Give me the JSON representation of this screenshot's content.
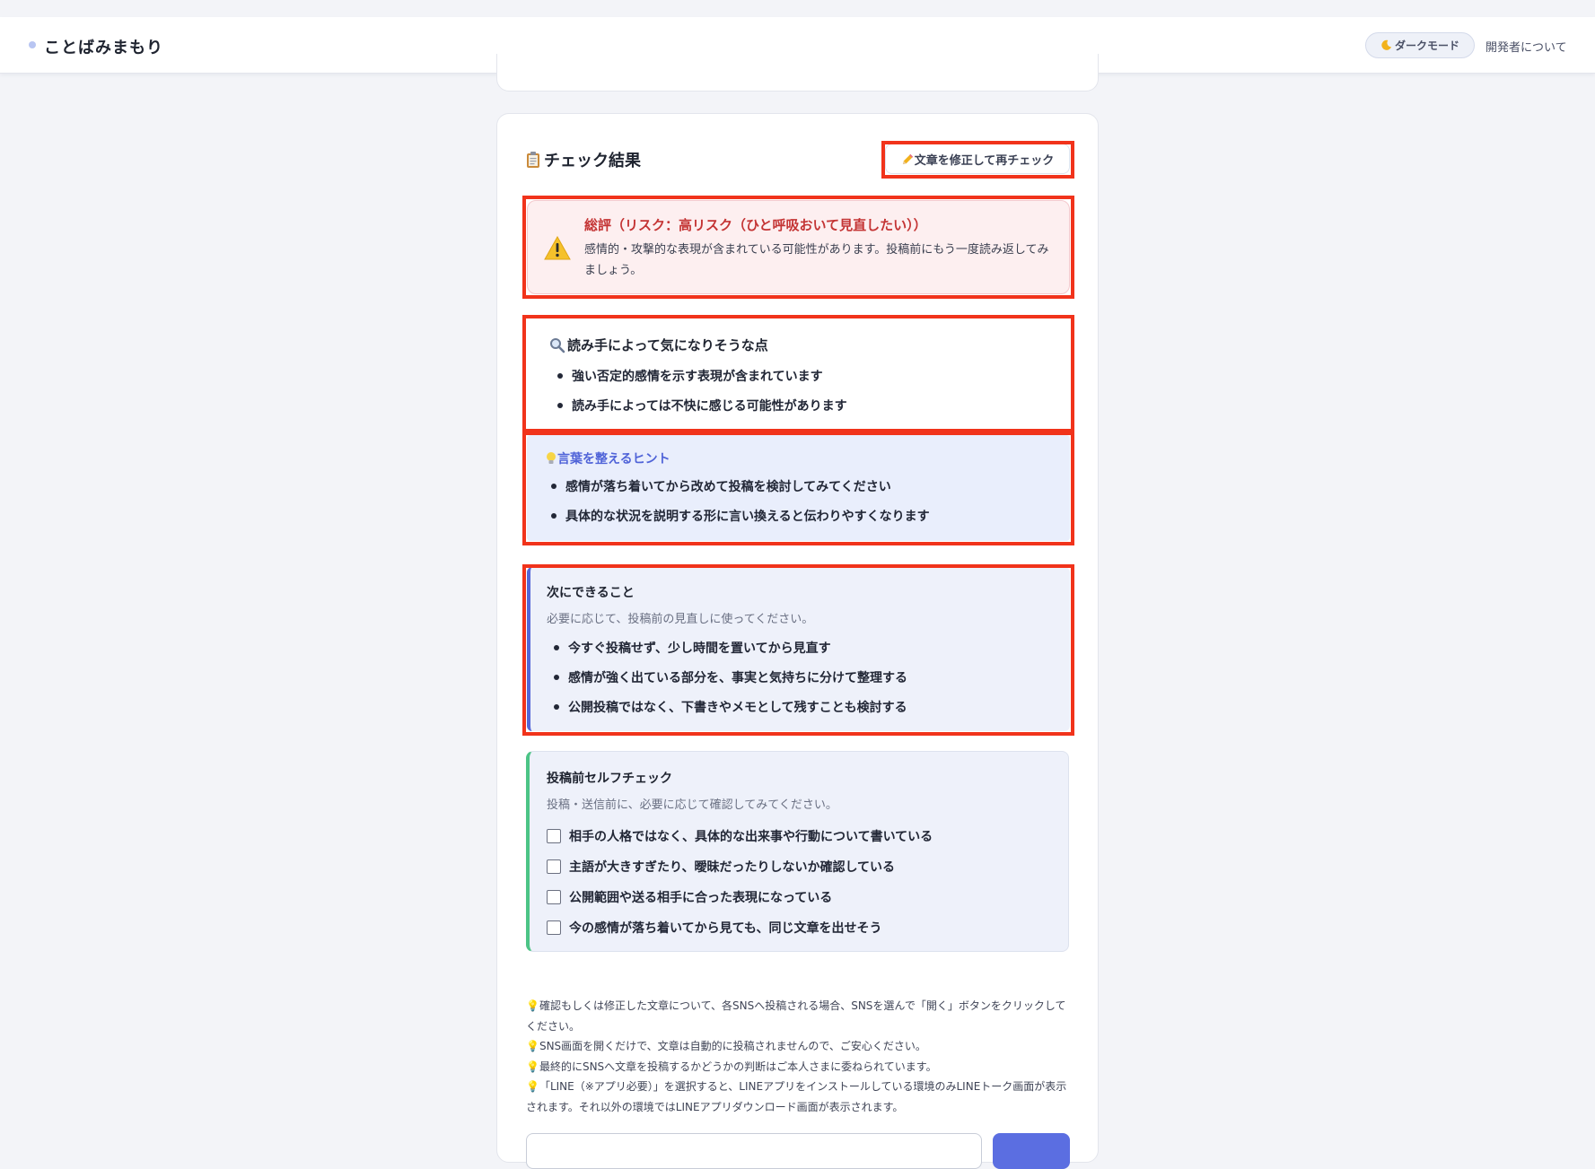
{
  "header": {
    "app_title": "ことばみまもり",
    "dark_mode_label": "ダークモード",
    "about_label": "開発者について"
  },
  "result": {
    "title": "チェック結果",
    "recheck_label": "文章を修正して再チェック",
    "summary_title": "総評（リスク：高リスク（ひと呼吸おいて見直したい））",
    "summary_text": "感情的・攻撃的な表現が含まれている可能性があります。投稿前にもう一度読み返してみましょう。"
  },
  "concerns": {
    "title": "読み手によって気になりそうな点",
    "items": [
      "強い否定的感情を示す表現が含まれています",
      "読み手によっては不快に感じる可能性があります"
    ]
  },
  "hints": {
    "title": "言葉を整えるヒント",
    "items": [
      "感情が落ち着いてから改めて投稿を検討してみてください",
      "具体的な状況を説明する形に言い換えると伝わりやすくなります"
    ]
  },
  "next_steps": {
    "title": "次にできること",
    "subtitle": "必要に応じて、投稿前の見直しに使ってください。",
    "items": [
      "今すぐ投稿せず、少し時間を置いてから見直す",
      "感情が強く出ている部分を、事実と気持ちに分けて整理する",
      "公開投稿ではなく、下書きやメモとして残すことも検討する"
    ]
  },
  "self_check": {
    "title": "投稿前セルフチェック",
    "subtitle": "投稿・送信前に、必要に応じて確認してみてください。",
    "items": [
      {
        "label": "相手の人格ではなく、具体的な出来事や行動について書いている",
        "checked": false
      },
      {
        "label": "主語が大きすぎたり、曖昧だったりしないか確認している",
        "checked": false
      },
      {
        "label": "公開範囲や送る相手に合った表現になっている",
        "checked": false
      },
      {
        "label": "今の感情が落ち着いてから見ても、同じ文章を出せそう",
        "checked": false
      }
    ]
  },
  "notes": [
    "確認もしくは修正した文章について、各SNSへ投稿される場合、SNSを選んで「開く」ボタンをクリックしてください。",
    "SNS画面を開くだけで、文章は自動的に投稿されませんので、ご安心ください。",
    "最終的にSNSへ文章を投稿するかどうかの判断はご本人さまに委ねられています。",
    "「LINE（※アプリ必要）」を選択すると、LINEアプリをインストールしている環境のみLINEトーク画面が表示されます。それ以外の環境ではLINEアプリダウンロード画面が表示されます。"
  ],
  "icons": {
    "header_dot": "dot-icon",
    "dark_mode": "moon-icon",
    "result": "clipboard-icon",
    "recheck": "pencil-icon",
    "summary": "warning-icon",
    "concerns": "magnifier-icon",
    "hints": "lightbulb-icon",
    "notes": "lightbulb-icon"
  },
  "colors": {
    "highlight_border": "#f1331b",
    "accent": "#5567d8",
    "risk_red": "#c43434",
    "self_check_accent": "#4cc486"
  }
}
